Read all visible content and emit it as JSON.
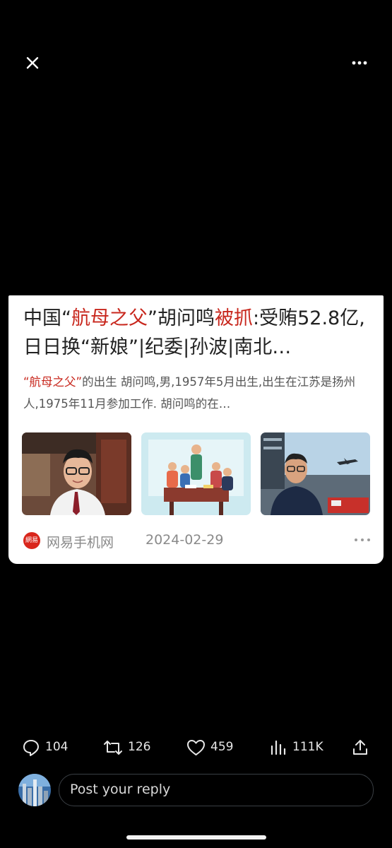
{
  "top_bar": {
    "close_icon": "close-icon",
    "more_icon": "more-horizontal-icon"
  },
  "card": {
    "title_parts": [
      "中国“",
      "航母之父",
      "”胡问鸣",
      "被抓",
      ":受贿52.8亿,日日换“新娘”|纪委|孙波|南北…"
    ],
    "summary_highlight": "“航母之父”",
    "summary_rest": "的出生 胡问鸣,男,1957年5月出生,出生在江苏是扬州人,1975年11月参加工作. 胡问鸣的在…",
    "images": [
      {
        "name": "portrait-photo"
      },
      {
        "name": "meeting-illustration"
      },
      {
        "name": "carrier-deck-photo"
      }
    ],
    "source": {
      "logo_text": "網易",
      "name": "网易手机网",
      "date": "2024-02-29"
    },
    "accent_color": "#c8271d"
  },
  "actions": {
    "replies": "104",
    "reposts": "126",
    "likes": "459",
    "views": "111K"
  },
  "reply": {
    "placeholder": "Post your reply"
  }
}
